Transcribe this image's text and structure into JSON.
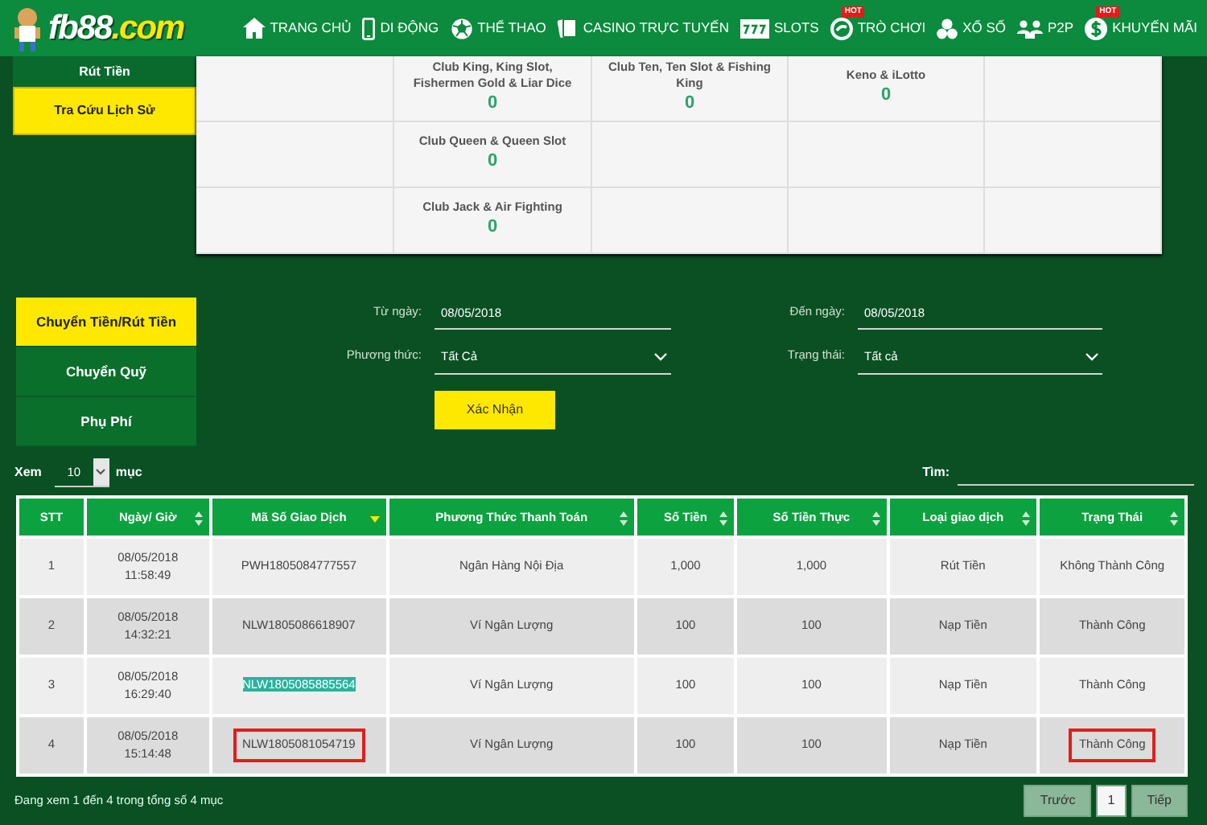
{
  "logo": {
    "text": "fb88",
    "suffix": ".com"
  },
  "nav": [
    {
      "label": "TRANG CHỦ"
    },
    {
      "label": "DI ĐỘNG"
    },
    {
      "label": "THỂ THAO"
    },
    {
      "label": "CASINO TRỰC TUYẾN"
    },
    {
      "label": "SLOTS"
    },
    {
      "label": "TRÒ CHƠI",
      "badge": "HOT"
    },
    {
      "label": "XỔ SỐ"
    },
    {
      "label": "P2P"
    },
    {
      "label": "KHUYẾN MÃI",
      "badge": "HOT"
    }
  ],
  "top_sidebar": [
    {
      "label": "Rút Tiền",
      "selected": false
    },
    {
      "label": "Tra Cứu Lịch Sử",
      "selected": true
    }
  ],
  "games": [
    {
      "name": "Club King, King Slot, Fishermen Gold & Liar Dice",
      "value": "0"
    },
    {
      "name": "Club Ten, Ten Slot & Fishing King",
      "value": "0"
    },
    {
      "name": "Keno & iLotto",
      "value": "0"
    },
    {
      "name": "Club Queen & Queen Slot",
      "value": "0"
    },
    {
      "name": "Club Jack & Air Fighting",
      "value": "0"
    }
  ],
  "sidebar": [
    {
      "label": "Chuyển Tiền/Rút Tiền",
      "selected": true
    },
    {
      "label": "Chuyển Quỹ",
      "selected": false
    },
    {
      "label": "Phụ Phí",
      "selected": false
    }
  ],
  "filters": [
    {
      "label": "Từ ngày:",
      "kind": "text",
      "value": "08/05/2018"
    },
    {
      "label": "Đến ngày:",
      "kind": "text",
      "value": "08/05/2018"
    },
    {
      "label": "Phương thức:",
      "kind": "select",
      "value": "Tất Cả"
    },
    {
      "label": "Trạng thái:",
      "kind": "select",
      "value": "Tất cả"
    }
  ],
  "submit": "Xác Nhận",
  "show": {
    "prefix": "Xem",
    "value": "10",
    "suffix": "mục"
  },
  "search": {
    "label": "Tìm:"
  },
  "table": {
    "columns": [
      {
        "label": "STT",
        "sortable": false,
        "sorted": false
      },
      {
        "label": "Ngày/ Giờ",
        "sortable": true,
        "sorted": false
      },
      {
        "label": "Mã Số Giao Dịch",
        "sortable": true,
        "sorted": true
      },
      {
        "label": "Phương Thức Thanh Toán",
        "sortable": true,
        "sorted": false
      },
      {
        "label": "Số Tiền",
        "sortable": true,
        "sorted": false
      },
      {
        "label": "Số Tiền Thực",
        "sortable": true,
        "sorted": false
      },
      {
        "label": "Loại giao dịch",
        "sortable": true,
        "sorted": false
      },
      {
        "label": "Trạng Thái",
        "sortable": true,
        "sorted": false
      }
    ],
    "rows": [
      {
        "cells": [
          "1",
          "08/05/2018\n11:58:49",
          "PWH1805084777557",
          "Ngân Hàng Nội Địa",
          "1,000",
          "1,000",
          "Rút Tiền",
          "Không Thành Công"
        ],
        "code_text_selected": false,
        "highlighted": false
      },
      {
        "cells": [
          "2",
          "08/05/2018\n14:32:21",
          "NLW1805086618907",
          "Ví Ngân Lượng",
          "100",
          "100",
          "Nạp Tiền",
          "Thành Công"
        ],
        "code_text_selected": false,
        "highlighted": false
      },
      {
        "cells": [
          "3",
          "08/05/2018\n16:29:40",
          "NLW1805085885564",
          "Ví Ngân Lượng",
          "100",
          "100",
          "Nạp Tiền",
          "Thành Công"
        ],
        "code_text_selected": true,
        "highlighted": false
      },
      {
        "cells": [
          "4",
          "08/05/2018\n15:14:48",
          "NLW1805081054719",
          "Ví Ngân Lượng",
          "100",
          "100",
          "Nạp Tiền",
          "Thành Công"
        ],
        "code_text_selected": false,
        "highlighted": true
      }
    ]
  },
  "footer": "Đang xem 1 đến 4 trong tổng số 4 mục",
  "pagination": [
    {
      "label": "Trước",
      "selected": false
    },
    {
      "label": "1",
      "selected": true
    },
    {
      "label": "Tiếp",
      "selected": false
    }
  ]
}
